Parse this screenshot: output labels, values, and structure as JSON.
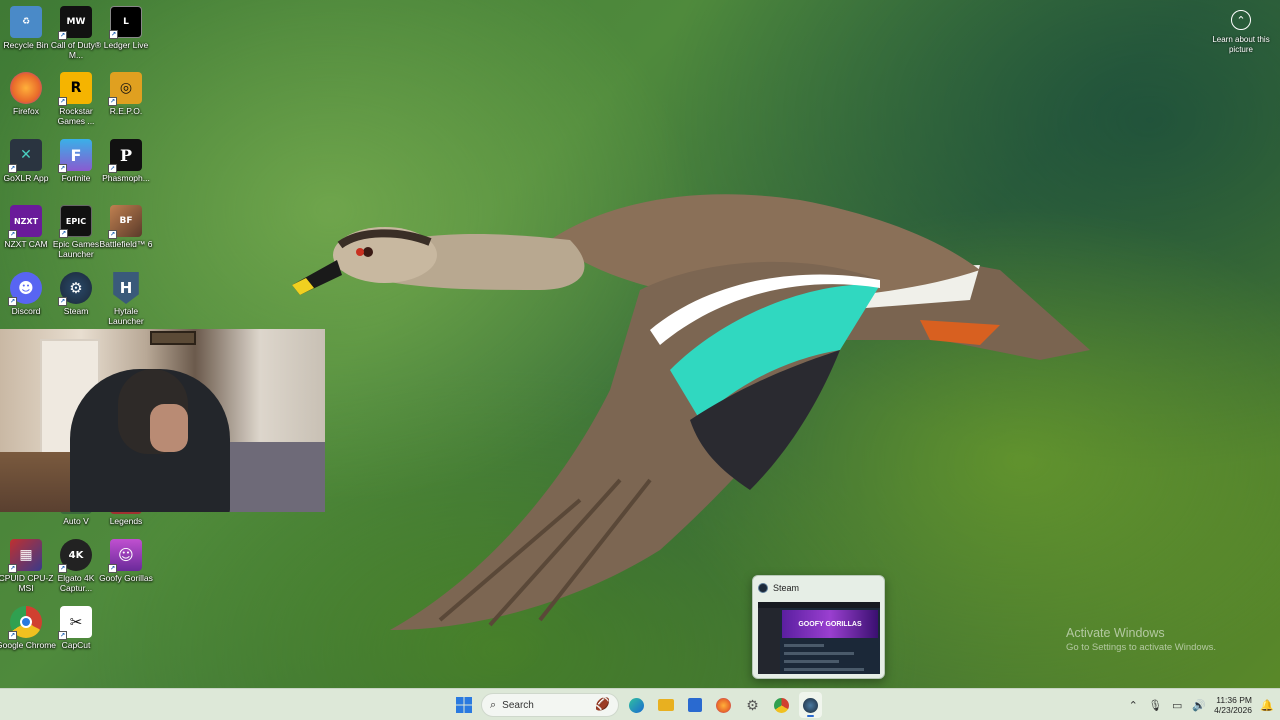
{
  "desktop_icons": [
    {
      "id": "recycle",
      "label": "Recycle Bin",
      "icon": "recycle-bin-icon",
      "color": "#4a8ac8",
      "glyph": "♻"
    },
    {
      "id": "cod",
      "label": "Call of Duty® M...",
      "icon": "call-of-duty-icon",
      "color": "#111111",
      "glyph": "MW"
    },
    {
      "id": "ledger",
      "label": "Ledger Live",
      "icon": "ledger-live-icon",
      "color": "#000000",
      "glyph": "L"
    },
    {
      "id": "firefox",
      "label": "Firefox",
      "icon": "firefox-icon",
      "color": "#e8692a",
      "glyph": "🦊"
    },
    {
      "id": "rockstar",
      "label": "Rockstar Games ...",
      "icon": "rockstar-icon",
      "color": "#f5b400",
      "glyph": "R"
    },
    {
      "id": "repo",
      "label": "R.E.P.O.",
      "icon": "repo-icon",
      "color": "#e0a020",
      "glyph": "◎"
    },
    {
      "id": "goxlr",
      "label": "GoXLR App",
      "icon": "goxlr-icon",
      "color": "#2a3440",
      "glyph": "✕"
    },
    {
      "id": "fortnite",
      "label": "Fortnite",
      "icon": "fortnite-icon",
      "color": "#3ab0e8",
      "glyph": "F"
    },
    {
      "id": "phasmo",
      "label": "Phasmoph...",
      "icon": "phasmophobia-icon",
      "color": "#111111",
      "glyph": "P"
    },
    {
      "id": "nzxt",
      "label": "NZXT CAM",
      "icon": "nzxt-cam-icon",
      "color": "#6a1b9a",
      "glyph": "NZXT"
    },
    {
      "id": "epic",
      "label": "Epic Games Launcher",
      "icon": "epic-games-icon",
      "color": "#111111",
      "glyph": "EPIC"
    },
    {
      "id": "bf6",
      "label": "Battlefield™ 6",
      "icon": "battlefield-icon",
      "color": "#8a5a3a",
      "glyph": "BF"
    },
    {
      "id": "discord",
      "label": "Discord",
      "icon": "discord-icon",
      "color": "#5865f2",
      "glyph": "☻"
    },
    {
      "id": "steam",
      "label": "Steam",
      "icon": "steam-icon",
      "color": "#1b2838",
      "glyph": "⚙"
    },
    {
      "id": "hytale",
      "label": "Hytale Launcher",
      "icon": "hytale-icon",
      "color": "#3a5a7a",
      "glyph": "H"
    },
    {
      "id": "gta",
      "label": "Auto V",
      "icon": "gta-icon",
      "color": "#3a6a3a",
      "glyph": ""
    },
    {
      "id": "apex",
      "label": "Legends",
      "icon": "apex-icon",
      "color": "#a03030",
      "glyph": ""
    },
    {
      "id": "cpuz",
      "label": "CPUID CPU-Z MSI",
      "icon": "cpuz-icon",
      "color": "#c03030",
      "glyph": "▦"
    },
    {
      "id": "elgato",
      "label": "Elgato 4K Captur...",
      "icon": "elgato-icon",
      "color": "#222222",
      "glyph": "4K"
    },
    {
      "id": "goofy",
      "label": "Goofy Gorillas",
      "icon": "goofy-gorillas-icon",
      "color": "#9a3ac0",
      "glyph": "☺"
    },
    {
      "id": "chrome",
      "label": "Google Chrome",
      "icon": "chrome-icon",
      "color": "#ffffff",
      "glyph": "◉"
    },
    {
      "id": "capcut",
      "label": "CapCut",
      "icon": "capcut-icon",
      "color": "#111111",
      "glyph": "✂"
    }
  ],
  "learn_picture": {
    "label": "Learn about this picture",
    "icon": "learn-about-picture-icon"
  },
  "activate_windows": {
    "title": "Activate Windows",
    "subtitle": "Go to Settings to activate Windows."
  },
  "steam_preview": {
    "title": "Steam",
    "banner": "GOOFY GORILLAS"
  },
  "taskbar": {
    "search_placeholder": "Search",
    "apps": [
      {
        "name": "edge-icon",
        "glyph": "◐",
        "color": "#1a8ad0"
      },
      {
        "name": "file-explorer-icon",
        "glyph": "▬",
        "color": "#e8b020"
      },
      {
        "name": "microsoft-store-icon",
        "glyph": "■",
        "color": "#2a6ad0"
      },
      {
        "name": "firefox-icon",
        "glyph": "●",
        "color": "#e8692a"
      },
      {
        "name": "settings-icon",
        "glyph": "⚙",
        "color": "#555555"
      },
      {
        "name": "chrome-icon",
        "glyph": "◉",
        "color": "#d04030"
      },
      {
        "name": "steam-icon",
        "glyph": "⚙",
        "color": "#1b2838"
      }
    ],
    "clock_time": "11:36 PM",
    "clock_date": "4/23/2026"
  }
}
